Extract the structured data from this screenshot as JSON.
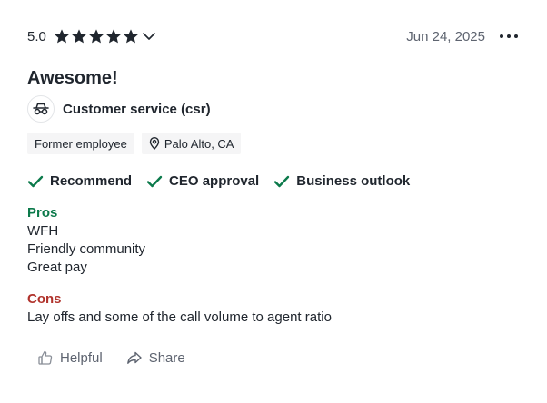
{
  "review": {
    "rating": "5.0",
    "star_count": 5,
    "date": "Jun 24, 2025",
    "title": "Awesome!",
    "job_title": "Customer service (csr)",
    "employment_status": "Former employee",
    "location": "Palo Alto, CA",
    "badges": [
      "Recommend",
      "CEO approval",
      "Business outlook"
    ],
    "pros_label": "Pros",
    "pros_lines": [
      "WFH",
      "Friendly community",
      "Great pay"
    ],
    "cons_label": "Cons",
    "cons_lines": [
      "Lay offs and some of the call volume to agent ratio"
    ]
  },
  "actions": {
    "helpful_label": "Helpful",
    "share_label": "Share"
  },
  "icons": {
    "star": "star-icon",
    "expand": "chevron-down-icon",
    "more": "more-options-icon",
    "job": "job-vehicle-icon",
    "location": "location-pin-icon",
    "check": "checkmark-icon",
    "helpful": "hand-thumb-icon",
    "share": "share-arrow-icon"
  },
  "colors": {
    "text": "#20262e",
    "muted": "#5e6470",
    "pros": "#0c7a4b",
    "cons": "#b0322b",
    "check": "#0c7a4b",
    "tag_bg": "#f5f5f6"
  }
}
